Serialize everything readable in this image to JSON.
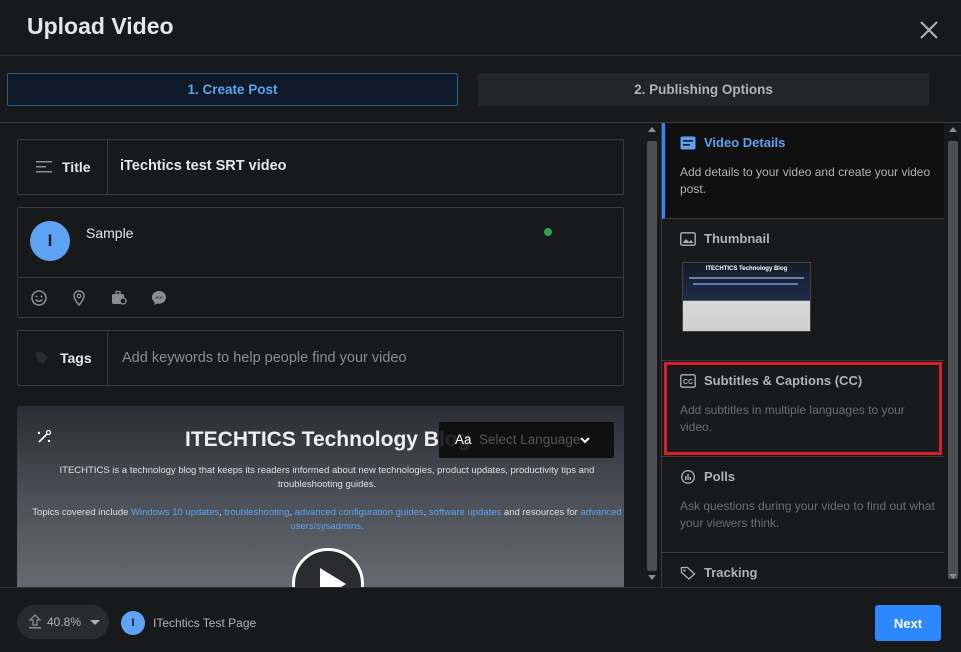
{
  "header": {
    "title": "Upload Video"
  },
  "tabs": [
    {
      "label": "1. Create Post",
      "active": true
    },
    {
      "label": "2. Publishing Options",
      "active": false
    }
  ],
  "form": {
    "title_label": "Title",
    "title_value": "iTechtics test SRT video",
    "post_text": "Sample",
    "avatar_letter": "I",
    "tags_label": "Tags",
    "tags_placeholder": "Add keywords to help people find your video"
  },
  "preview": {
    "heading": "ITECHTICS Technology Blog",
    "description": "ITECHTICS is a technology blog that keeps its readers informed about new technologies, product updates, productivity tips and troubleshooting guides.",
    "topics_prefix": "Topics covered include",
    "topics_link1": "Windows 10 updates",
    "topics_link2": "troubleshooting",
    "topics_link3": "advanced configuration guides",
    "topics_link4": "software updates",
    "topics_suffix": "and resources for",
    "topics_link5": "advanced users/sysadmins.",
    "language_aa": "Aa",
    "language_label": "Select Language"
  },
  "sidebar": {
    "sections": [
      {
        "title": "Video Details",
        "description": "Add details to your video and create your video post.",
        "active": true
      },
      {
        "title": "Thumbnail",
        "thumb_title": "ITECHTICS Technology Blog"
      },
      {
        "title": "Subtitles & Captions (CC)",
        "description": "Add subtitles in multiple languages to your video.",
        "highlighted": true
      },
      {
        "title": "Polls",
        "description": "Ask questions during your video to find out what your viewers think."
      },
      {
        "title": "Tracking"
      }
    ]
  },
  "footer": {
    "upload_percent": "40.8%",
    "page_avatar_letter": "I",
    "page_name": "ITechtics Test Page",
    "next_label": "Next"
  },
  "colors": {
    "background": "#18191a",
    "accent": "#2d88ff",
    "highlight": "#d4202a",
    "status_dot": "#31a24c"
  }
}
